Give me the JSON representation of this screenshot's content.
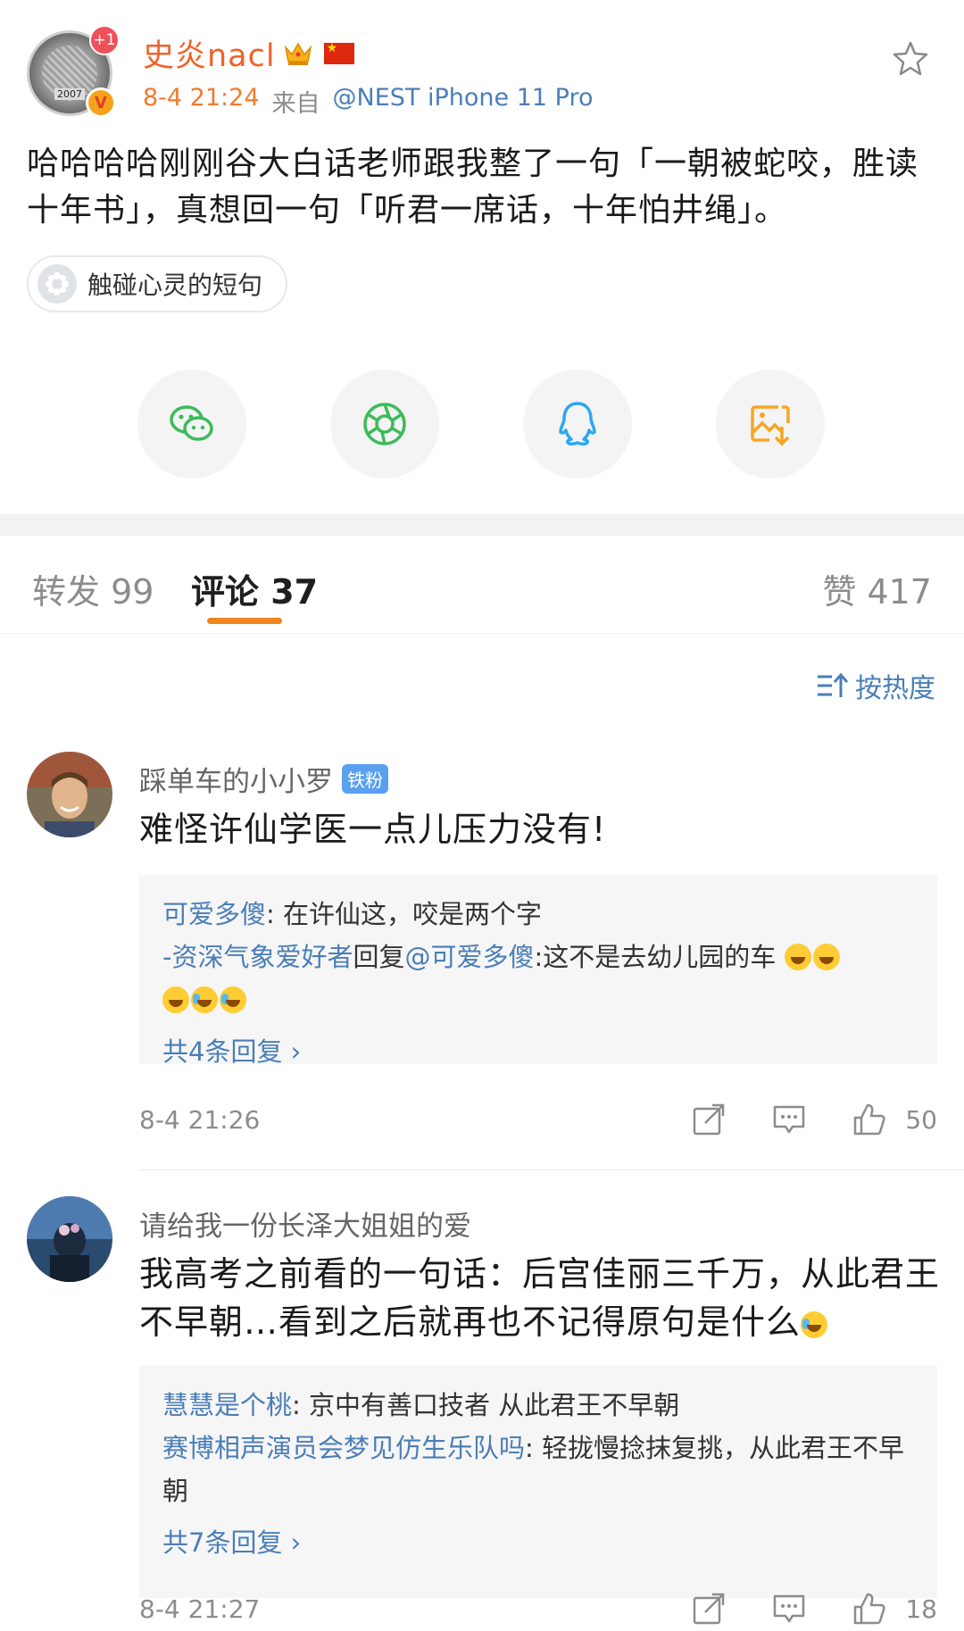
{
  "post": {
    "author": "史炎nacl",
    "plus_badge": "+1",
    "time": "8-4 21:24",
    "from_label": "来自",
    "device": "@NEST iPhone 11 Pro",
    "text": "哈哈哈哈刚刚谷大白话老师跟我整了一句「一朝被蛇咬，胜读十年书」，真想回一句「听君一席话，十年怕井绳」。",
    "topic": "触碰心灵的短句"
  },
  "share": {
    "items": [
      {
        "name": "wechat-icon",
        "color": "#3dbb5a"
      },
      {
        "name": "moments-icon",
        "color": "#3dbb5a"
      },
      {
        "name": "qq-icon",
        "color": "#2aa8f0"
      },
      {
        "name": "save-image-icon",
        "color": "#f5a623"
      }
    ]
  },
  "tabs": {
    "repost": "转发 99",
    "comments": "评论 37",
    "likes": "赞 417"
  },
  "sort": {
    "label": "按热度"
  },
  "comments": [
    {
      "user": "踩单车的小小罗",
      "badge": "铁粉",
      "text": "难怪许仙学医一点儿压力没有!",
      "replies": [
        {
          "nick": "可爱多傻",
          "sep": ": ",
          "text": "在许仙这，咬是两个字"
        },
        {
          "nick": "-资深气象爱好者",
          "mid": "回复",
          "mention": "@可爱多傻",
          "text": ":这不是去幼儿园的车"
        }
      ],
      "more": "共4条回复 ›",
      "time": "8-4 21:26",
      "likes": "50"
    },
    {
      "user": "请给我一份长泽大姐姐的爱",
      "text": "我高考之前看的一句话：后宫佳丽三千万，从此君王不早朝…看到之后就再也不记得原句是什么",
      "replies": [
        {
          "nick": "慧慧是个桃",
          "sep": ": ",
          "text": "京中有善口技者 从此君王不早朝"
        },
        {
          "nick": "赛博相声演员会梦见仿生乐队吗",
          "sep": ": ",
          "text": "轻拢慢捻抹复挑，从此君王不早朝"
        }
      ],
      "more": "共7条回复 ›",
      "time": "8-4 21:27",
      "likes": "18"
    }
  ],
  "colors": {
    "accent": "#f0861f",
    "link": "#4a7eb8",
    "author": "#f0622a"
  }
}
